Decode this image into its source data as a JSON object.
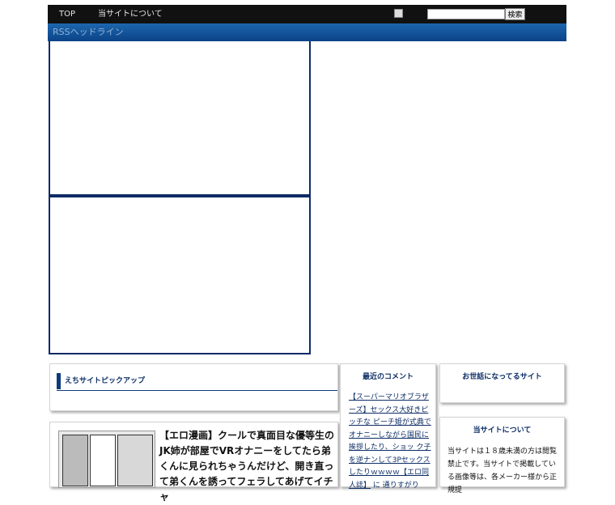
{
  "nav": {
    "items": [
      "TOP",
      "当サイトについて"
    ],
    "search_button": "検索",
    "search_value": ""
  },
  "rss": {
    "title": "RSSヘッドライン"
  },
  "pickup": {
    "title": "えちサイトピックアップ"
  },
  "article": {
    "title": "【エロ漫画】クールで真面目な優等生のJK姉が部屋でVRオナニーをしてたら弟くんに見られちゃうんだけど、開き直って弟くんを誘ってフェラしてあげてイチャ"
  },
  "comments": {
    "title": "最近のコメント",
    "link": "【スーパーマリオブラザーズ】セックス大好きピッチな ピーチ姫が式典でオナニーしながら国民に挨拶したり、ショッ ク子を逆ナンして3Pセックスしたりｗｗｗｗ【エロ同人誌】",
    "suffix": " に 通りすがり"
  },
  "thanks": {
    "title": "お世話になってるサイト"
  },
  "about": {
    "title": "当サイトについて",
    "text": "当サイトは１８歳未満の方は閲覧禁止です。当サイトで掲載している画像等は、各メーカー様から正規提"
  },
  "colors": {
    "nav_bg": "#111111",
    "rss_bar": "#0b4388",
    "accent": "#0d2e66"
  }
}
